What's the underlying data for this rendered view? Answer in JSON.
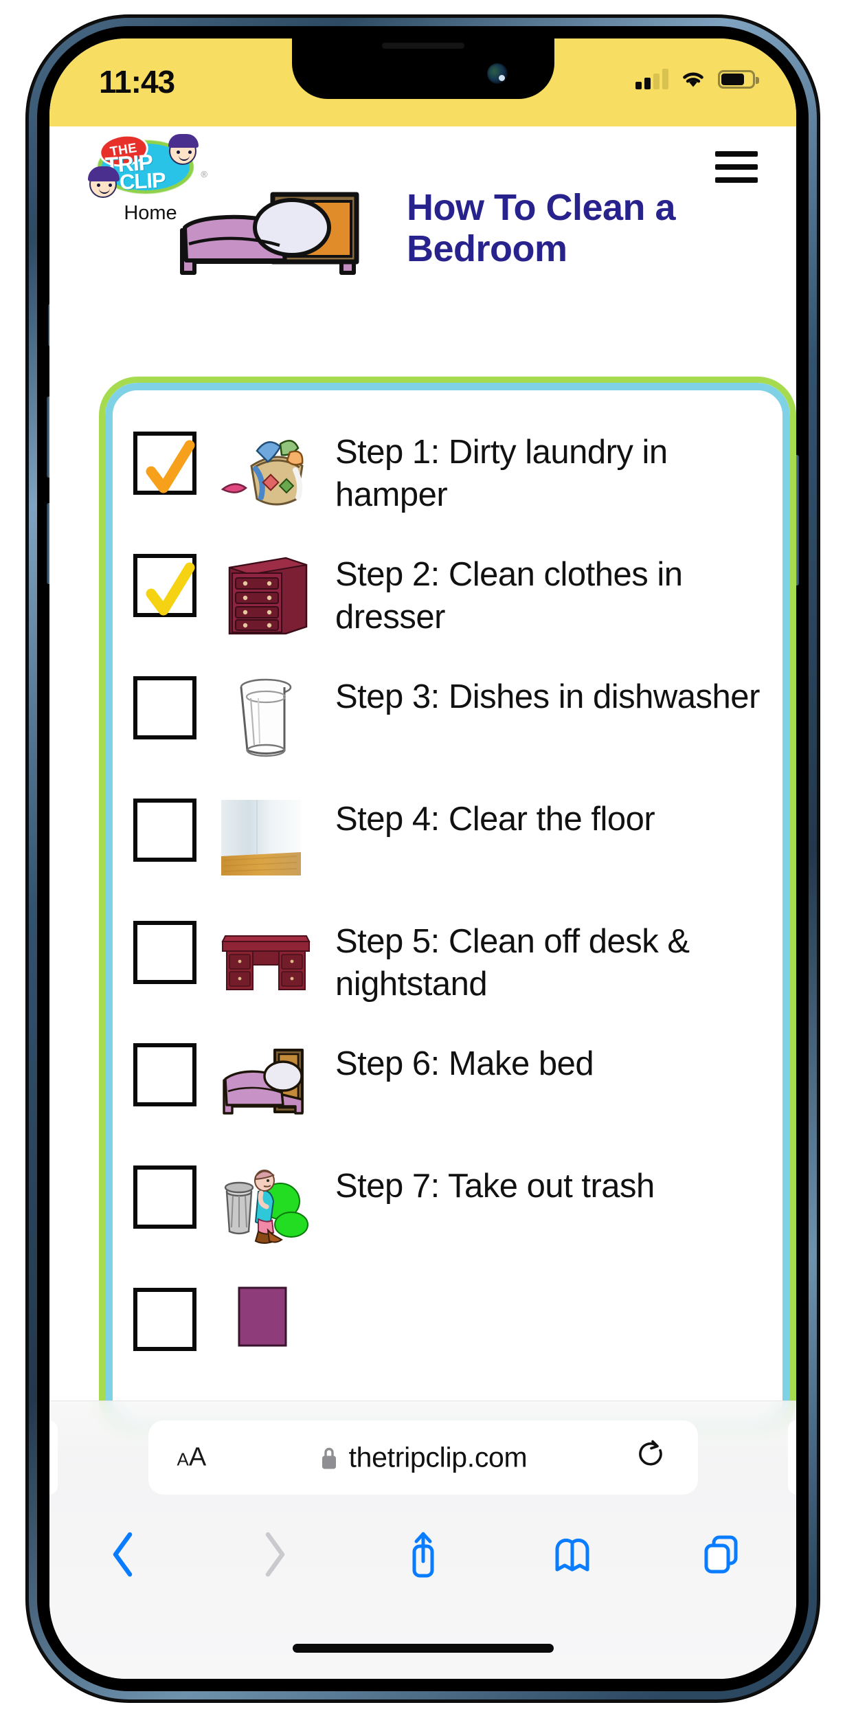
{
  "status_bar": {
    "time": "11:43",
    "signal_icon": "cellular-signal-icon",
    "signal_bars_filled": 2,
    "signal_bars_total": 4,
    "wifi_icon": "wifi-icon",
    "battery_icon": "battery-icon",
    "battery_level_percent": 68,
    "background_color": "#f7dd62"
  },
  "header": {
    "logo": {
      "badge_text": "THE",
      "line1": "TRIP",
      "line2": "CLIP",
      "registered_mark": "®",
      "badge_color": "#e8302b",
      "oval_color": "#29c3e8",
      "glow_color": "#8fd14a"
    },
    "home_label": "Home",
    "menu_icon": "hamburger-menu-icon",
    "title": "How To Clean a Bedroom",
    "title_color": "#27228c",
    "hero_image": "bed-illustration"
  },
  "checklist": {
    "card_border_outer_color": "#a6db4f",
    "card_border_inner_color": "#7fd2e6",
    "steps": [
      {
        "checkbox_state": "checked",
        "check_color": "#f7a01b",
        "image": "laundry-basket-image",
        "label": "Step 1: Dirty laundry in hamper"
      },
      {
        "checkbox_state": "checked",
        "check_color": "#f5d313",
        "image": "dresser-image",
        "label": "Step 2: Clean clothes in dresser"
      },
      {
        "checkbox_state": "unchecked",
        "check_color": "",
        "image": "drinking-glass-image",
        "label": "Step 3: Dishes in dishwasher"
      },
      {
        "checkbox_state": "unchecked",
        "check_color": "",
        "image": "clean-floor-photo",
        "label": "Step 4: Clear the floor"
      },
      {
        "checkbox_state": "unchecked",
        "check_color": "",
        "image": "desk-image",
        "label": "Step 5: Clean off desk & nightstand"
      },
      {
        "checkbox_state": "unchecked",
        "check_color": "",
        "image": "bed-image",
        "label": "Step 6: Make bed"
      },
      {
        "checkbox_state": "unchecked",
        "check_color": "",
        "image": "take-out-trash-image",
        "label": "Step 7: Take out trash"
      }
    ]
  },
  "browser": {
    "text_size_button_small": "A",
    "text_size_button_large": "A",
    "lock_icon": "lock-icon",
    "url": "thetripclip.com",
    "reload_icon": "reload-icon",
    "toolbar": [
      {
        "name": "back-button",
        "icon": "chevron-left-icon",
        "enabled": true
      },
      {
        "name": "forward-button",
        "icon": "chevron-right-icon",
        "enabled": false
      },
      {
        "name": "share-button",
        "icon": "share-icon",
        "enabled": true
      },
      {
        "name": "bookmarks-button",
        "icon": "book-icon",
        "enabled": true
      },
      {
        "name": "tabs-button",
        "icon": "tabs-icon",
        "enabled": true
      }
    ],
    "accent_color": "#0a7cff"
  }
}
